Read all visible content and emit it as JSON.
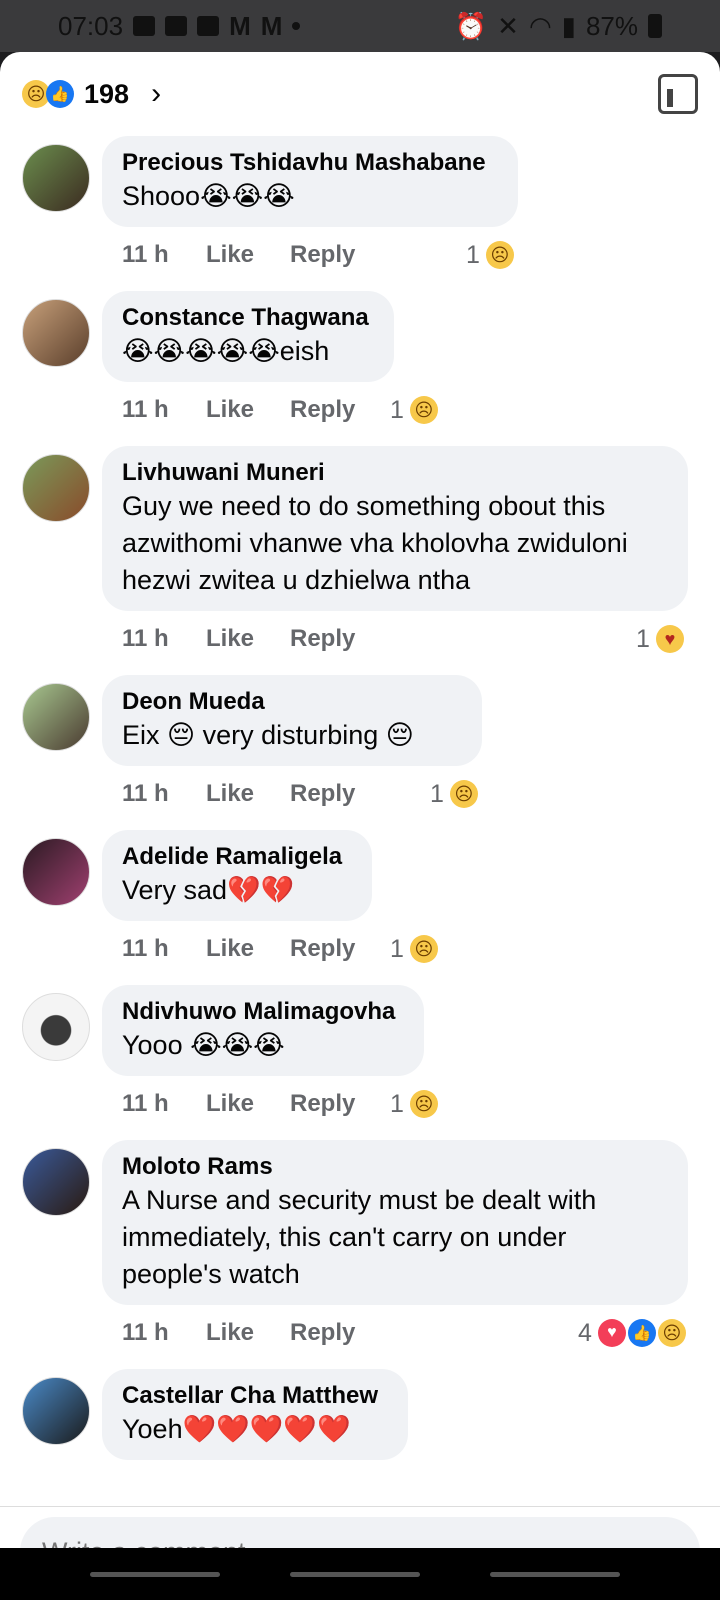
{
  "status": {
    "time": "07:03",
    "battery": "87%"
  },
  "header": {
    "reaction_count": "198"
  },
  "comments": [
    {
      "author": "Precious Tshidavhu Mashabane",
      "text": "Shooo😭😭😭",
      "time": "11 h",
      "like": "Like",
      "reply": "Reply",
      "reaction_count": "1"
    },
    {
      "author": "Constance Thagwana",
      "text": "😭😭😭😭😭eish",
      "time": "11 h",
      "like": "Like",
      "reply": "Reply",
      "reaction_count": "1"
    },
    {
      "author": "Livhuwani Muneri",
      "text": "Guy we need to do something obout this azwithomi vhanwe vha kholovha zwiduloni hezwi zwitea u dzhielwa ntha",
      "time": "11 h",
      "like": "Like",
      "reply": "Reply",
      "reaction_count": "1"
    },
    {
      "author": "Deon Mueda",
      "text": "Eix 😔 very disturbing 😔",
      "time": "11 h",
      "like": "Like",
      "reply": "Reply",
      "reaction_count": "1"
    },
    {
      "author": "Adelide Ramaligela",
      "text": "Very sad💔💔",
      "time": "11 h",
      "like": "Like",
      "reply": "Reply",
      "reaction_count": "1"
    },
    {
      "author": "Ndivhuwo Malimagovha",
      "text": "Yooo 😭😭😭",
      "time": "11 h",
      "like": "Like",
      "reply": "Reply",
      "reaction_count": "1"
    },
    {
      "author": "Moloto Rams",
      "text": "A Nurse and security must be dealt with immediately, this can't carry on under people's watch",
      "time": "11 h",
      "like": "Like",
      "reply": "Reply",
      "reaction_count": "4"
    },
    {
      "author": "Castellar Cha Matthew",
      "text": "Yoeh❤️❤️❤️❤️❤️"
    }
  ],
  "composer": {
    "placeholder": "Write a comment…"
  },
  "icons": {
    "sad": "sad-react-icon",
    "like": "like-react-icon",
    "love": "love-react-icon",
    "care": "care-react-icon"
  },
  "colors": {
    "like_blue": "#1877f2",
    "love_red": "#f33e58",
    "sad_yellow": "#f7c84a",
    "bubble_gray": "#f0f2f5"
  }
}
